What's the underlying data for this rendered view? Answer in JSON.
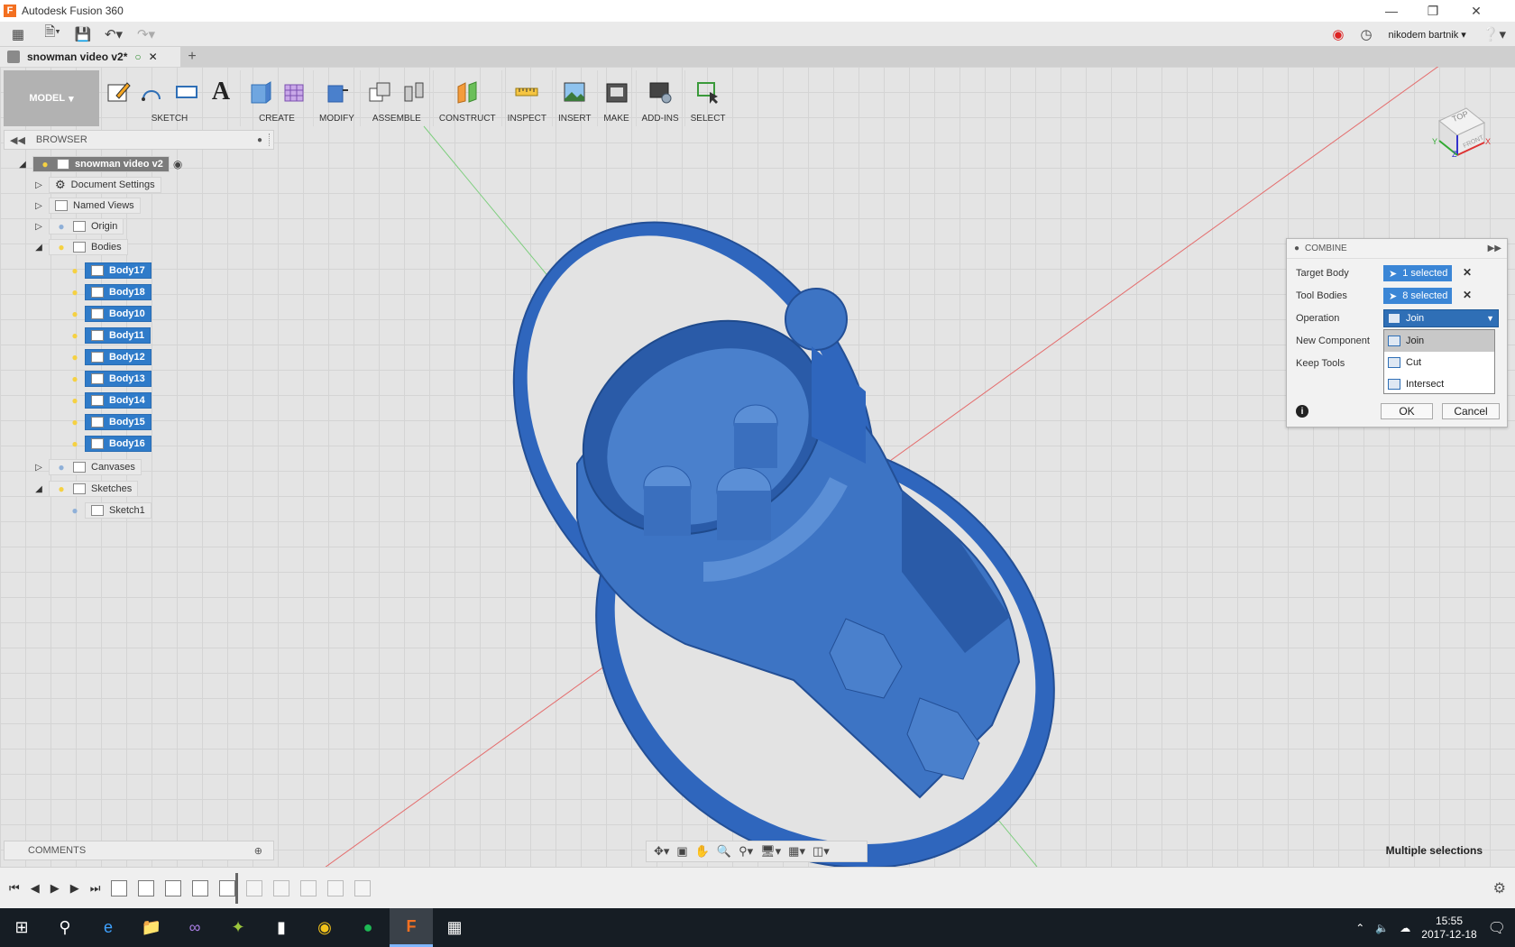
{
  "window": {
    "title": "Autodesk Fusion 360"
  },
  "quick_access": {
    "user": "nikodem bartnik"
  },
  "document_tab": {
    "label": "snowman video v2*"
  },
  "ribbon": {
    "workspace": "MODEL",
    "groups": [
      "SKETCH",
      "CREATE",
      "MODIFY",
      "ASSEMBLE",
      "CONSTRUCT",
      "INSPECT",
      "INSERT",
      "MAKE",
      "ADD-INS",
      "SELECT"
    ]
  },
  "browser": {
    "header": "BROWSER",
    "root": "snowman video v2",
    "nodes": [
      "Document Settings",
      "Named Views",
      "Origin",
      "Bodies",
      "Canvases",
      "Sketches"
    ],
    "bodies": [
      "Body17",
      "Body18",
      "Body10",
      "Body11",
      "Body12",
      "Body13",
      "Body14",
      "Body15",
      "Body16"
    ],
    "sketch": "Sketch1"
  },
  "viewcube": {
    "face": "TOP",
    "axis_x": "X",
    "axis_y": "Y",
    "axis_z": "Z",
    "front": "FRONT"
  },
  "combine": {
    "title": "COMBINE",
    "target_body_label": "Target Body",
    "target_body_value": "1 selected",
    "tool_bodies_label": "Tool Bodies",
    "tool_bodies_value": "8 selected",
    "operation_label": "Operation",
    "operation_value": "Join",
    "new_component_label": "New Component",
    "keep_tools_label": "Keep Tools",
    "options": [
      "Join",
      "Cut",
      "Intersect"
    ],
    "ok": "OK",
    "cancel": "Cancel"
  },
  "comments": {
    "label": "COMMENTS"
  },
  "status": {
    "text": "Multiple selections"
  },
  "clock": {
    "time": "15:55",
    "date": "2017-12-18"
  },
  "colors": {
    "model": "#3d74c4",
    "accent": "#2f7bc9"
  }
}
